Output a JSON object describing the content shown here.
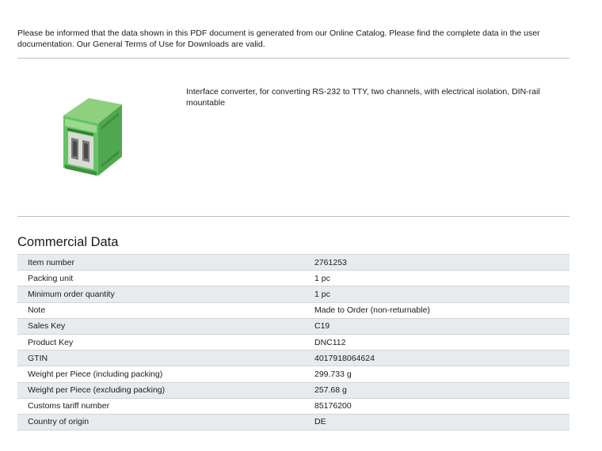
{
  "disclaimer": "Please be informed that the data shown in this PDF document is generated from our Online Catalog. Please find the complete data in the user documentation. Our General Terms of Use for Downloads are valid.",
  "product": {
    "description": "Interface converter, for converting RS-232 to TTY, two channels, with electrical isolation, DIN-rail mountable",
    "image_icon": "din-rail-interface-converter-icon",
    "colors": {
      "housing": "#5cb85c",
      "housing_dark": "#3f8f3f",
      "housing_light": "#8fd07f"
    }
  },
  "commercial": {
    "title": "Commercial Data",
    "rows": [
      {
        "label": "Item number",
        "value": "2761253"
      },
      {
        "label": "Packing unit",
        "value": "1 pc"
      },
      {
        "label": "Minimum order quantity",
        "value": "1 pc"
      },
      {
        "label": "Note",
        "value": "Made to Order (non-returnable)"
      },
      {
        "label": "Sales Key",
        "value": "C19"
      },
      {
        "label": "Product Key",
        "value": "DNC112"
      },
      {
        "label": "GTIN",
        "value": "4017918064624"
      },
      {
        "label": "Weight per Piece (including packing)",
        "value": "299.733 g"
      },
      {
        "label": "Weight per Piece (excluding packing)",
        "value": "257.68 g"
      },
      {
        "label": "Customs tariff number",
        "value": "85176200"
      },
      {
        "label": "Country of origin",
        "value": "DE"
      }
    ]
  }
}
